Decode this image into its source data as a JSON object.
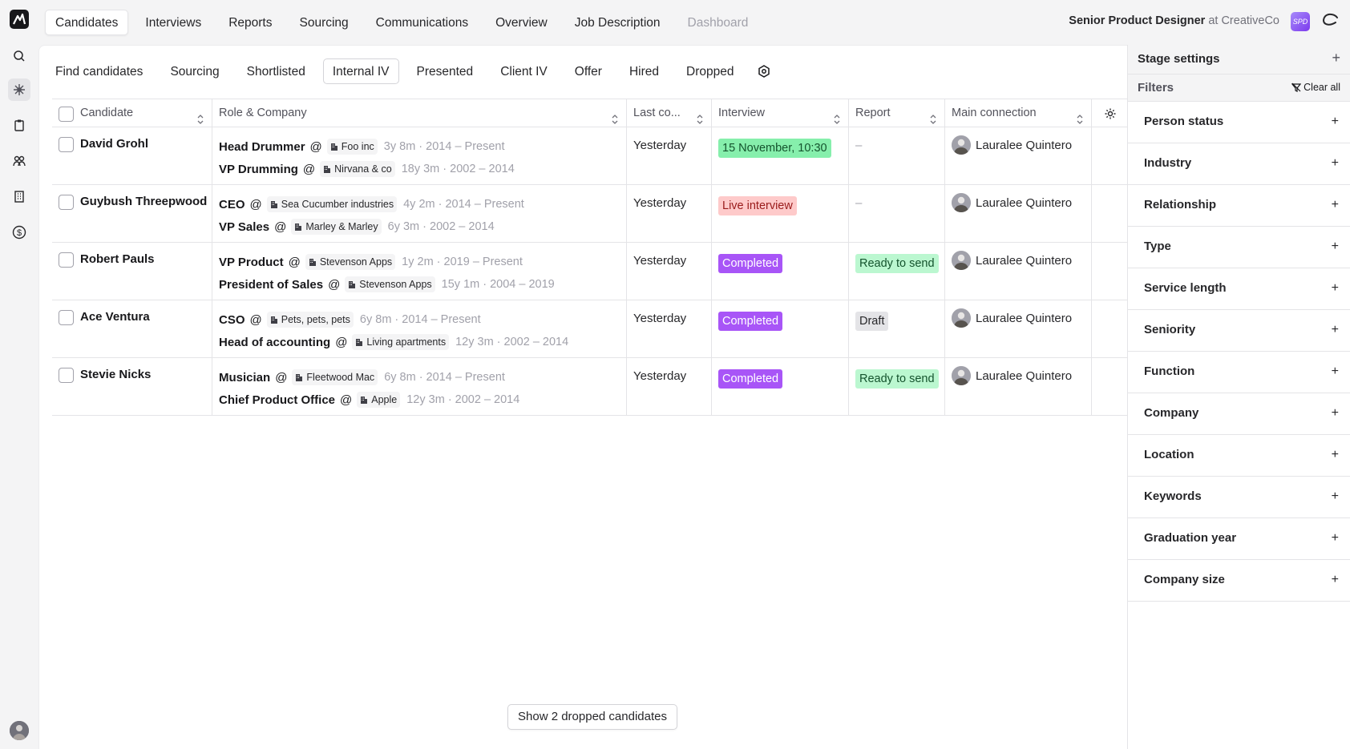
{
  "app": {
    "job_title": "Senior Product Designer",
    "at_company": "at CreativeCo",
    "avatar_initials": "SPD"
  },
  "topnav": [
    {
      "label": "Candidates",
      "active": true
    },
    {
      "label": "Interviews"
    },
    {
      "label": "Reports"
    },
    {
      "label": "Sourcing"
    },
    {
      "label": "Communications"
    },
    {
      "label": "Overview"
    },
    {
      "label": "Job Description"
    },
    {
      "label": "Dashboard",
      "disabled": true
    }
  ],
  "stage_tabs": [
    {
      "label": "Find candidates"
    },
    {
      "label": "Sourcing"
    },
    {
      "label": "Shortlisted"
    },
    {
      "label": "Internal IV",
      "active": true
    },
    {
      "label": "Presented"
    },
    {
      "label": "Client IV"
    },
    {
      "label": "Offer"
    },
    {
      "label": "Hired"
    },
    {
      "label": "Dropped"
    }
  ],
  "table": {
    "headers": {
      "candidate": "Candidate",
      "role": "Role & Company",
      "last": "Last co...",
      "interview": "Interview",
      "report": "Report",
      "connection": "Main connection"
    },
    "rows": [
      {
        "name": "David Grohl",
        "roles": [
          {
            "title": "Head Drummer",
            "company": "Foo inc",
            "tenure": "3y 8m · 2014 – Present"
          },
          {
            "title": "VP Drumming",
            "company": "Nirvana & co",
            "tenure": "18y 3m · 2002 – 2014"
          }
        ],
        "last": "Yesterday",
        "interview": {
          "text": "15 November, 10:30",
          "style": "green"
        },
        "report": {
          "text": "–",
          "style": "none"
        },
        "connection": "Lauralee Quintero"
      },
      {
        "name": "Guybush Threepwood",
        "roles": [
          {
            "title": "CEO",
            "company": "Sea Cucumber industries",
            "tenure": "4y 2m · 2014 – Present"
          },
          {
            "title": "VP Sales",
            "company": "Marley & Marley",
            "tenure": "6y 3m · 2002 – 2014"
          }
        ],
        "last": "Yesterday",
        "interview": {
          "text": "Live interview",
          "style": "red"
        },
        "report": {
          "text": "–",
          "style": "none"
        },
        "connection": "Lauralee Quintero"
      },
      {
        "name": "Robert Pauls",
        "roles": [
          {
            "title": "VP Product",
            "company": "Stevenson Apps",
            "tenure": "1y 2m · 2019 – Present"
          },
          {
            "title": "President of Sales",
            "company": "Stevenson Apps",
            "tenure": "15y 1m · 2004 – 2019"
          }
        ],
        "last": "Yesterday",
        "interview": {
          "text": "Completed",
          "style": "purple"
        },
        "report": {
          "text": "Ready to send",
          "style": "ready"
        },
        "connection": "Lauralee Quintero"
      },
      {
        "name": "Ace Ventura",
        "roles": [
          {
            "title": "CSO",
            "company": "Pets, pets, pets",
            "tenure": "6y 8m · 2014 – Present"
          },
          {
            "title": "Head of accounting",
            "company": "Living apartments",
            "tenure": "12y 3m · 2002 – 2014"
          }
        ],
        "last": "Yesterday",
        "interview": {
          "text": "Completed",
          "style": "purple"
        },
        "report": {
          "text": "Draft",
          "style": "draft"
        },
        "connection": "Lauralee Quintero"
      },
      {
        "name": "Stevie Nicks",
        "roles": [
          {
            "title": "Musician",
            "company": "Fleetwood Mac",
            "tenure": "6y 8m · 2014 – Present"
          },
          {
            "title": "Chief Product Office",
            "company": "Apple",
            "tenure": "12y 3m · 2002 – 2014"
          }
        ],
        "last": "Yesterday",
        "interview": {
          "text": "Completed",
          "style": "purple"
        },
        "report": {
          "text": "Ready to send",
          "style": "ready"
        },
        "connection": "Lauralee Quintero"
      }
    ]
  },
  "dropped_button": "Show 2 dropped candidates",
  "side": {
    "stage_settings": "Stage settings",
    "filters_label": "Filters",
    "clear_all": "Clear all",
    "filters": [
      "Person status",
      "Industry",
      "Relationship",
      "Type",
      "Service length",
      "Seniority",
      "Function",
      "Company",
      "Location",
      "Keywords",
      "Graduation year",
      "Company size"
    ]
  },
  "colors": {
    "interview_green": "#86efac",
    "interview_red": "#fecaca",
    "completed_purple": "#a855f7",
    "ready_green": "#bbf7d0",
    "draft_gray": "#e4e4e7"
  }
}
